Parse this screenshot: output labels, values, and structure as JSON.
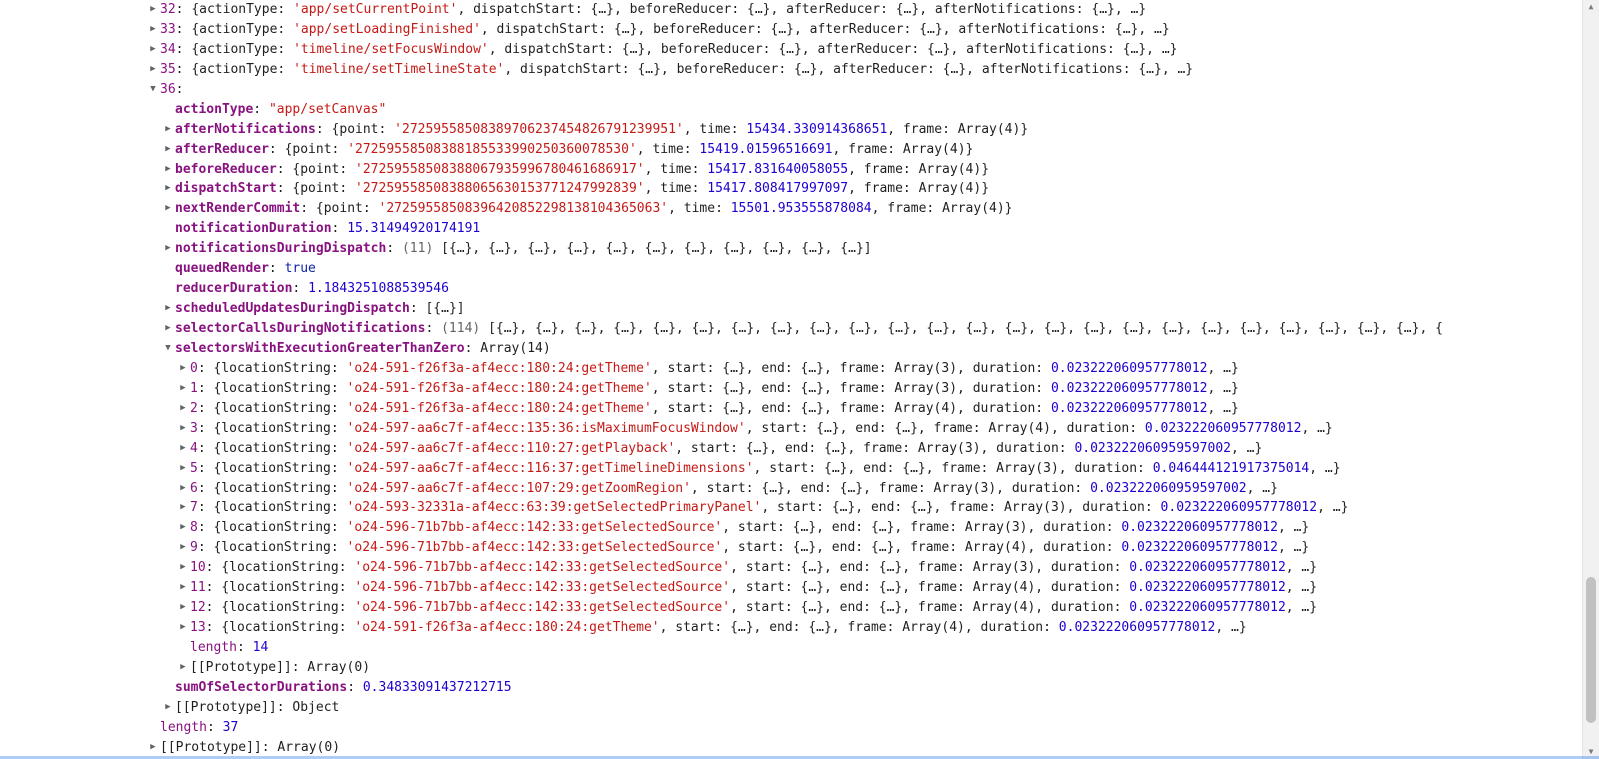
{
  "icons": {
    "collapsed": "▶",
    "expanded": "▼",
    "scroll_up": "▲",
    "scroll_down": "▼"
  },
  "colors": {
    "key": "#881280",
    "string": "#c41a16",
    "number": "#1c00cf",
    "boolean": "#0d22aa",
    "text": "#1f1f1f"
  },
  "lines": [
    {
      "indent": 0,
      "arrow": "collapsed",
      "key": "32",
      "sep": ": ",
      "parts": [
        [
          "plain",
          "{actionType: "
        ],
        [
          "str",
          "'app/setCurrentPoint'"
        ],
        [
          "plain",
          ", dispatchStart: {…}, beforeReducer: {…}, afterReducer: {…}, afterNotifications: {…}, …}"
        ]
      ]
    },
    {
      "indent": 0,
      "arrow": "collapsed",
      "key": "33",
      "sep": ": ",
      "parts": [
        [
          "plain",
          "{actionType: "
        ],
        [
          "str",
          "'app/setLoadingFinished'"
        ],
        [
          "plain",
          ", dispatchStart: {…}, beforeReducer: {…}, afterReducer: {…}, afterNotifications: {…}, …}"
        ]
      ]
    },
    {
      "indent": 0,
      "arrow": "collapsed",
      "key": "34",
      "sep": ": ",
      "parts": [
        [
          "plain",
          "{actionType: "
        ],
        [
          "str",
          "'timeline/setFocusWindow'"
        ],
        [
          "plain",
          ", dispatchStart: {…}, beforeReducer: {…}, afterReducer: {…}, afterNotifications: {…}, …}"
        ]
      ]
    },
    {
      "indent": 0,
      "arrow": "collapsed",
      "key": "35",
      "sep": ": ",
      "parts": [
        [
          "plain",
          "{actionType: "
        ],
        [
          "str",
          "'timeline/setTimelineState'"
        ],
        [
          "plain",
          ", dispatchStart: {…}, beforeReducer: {…}, afterReducer: {…}, afterNotifications: {…}, …}"
        ]
      ]
    },
    {
      "indent": 0,
      "arrow": "expanded",
      "key": "36",
      "sep": ":",
      "parts": []
    },
    {
      "indent": 1,
      "arrow": "",
      "key": "actionType",
      "sep": ": ",
      "parts": [
        [
          "str",
          "\"app/setCanvas\""
        ]
      ]
    },
    {
      "indent": 1,
      "arrow": "collapsed",
      "key": "afterNotifications",
      "sep": ": ",
      "parts": [
        [
          "plain",
          "{point: "
        ],
        [
          "str",
          "'27259558508389706237454826791239951'"
        ],
        [
          "plain",
          ", time: "
        ],
        [
          "num",
          "15434.330914368651"
        ],
        [
          "plain",
          ", frame: Array(4)}"
        ]
      ]
    },
    {
      "indent": 1,
      "arrow": "collapsed",
      "key": "afterReducer",
      "sep": ": ",
      "parts": [
        [
          "plain",
          "{point: "
        ],
        [
          "str",
          "'27259558508388185533990250360078530'"
        ],
        [
          "plain",
          ", time: "
        ],
        [
          "num",
          "15419.01596516691"
        ],
        [
          "plain",
          ", frame: Array(4)}"
        ]
      ]
    },
    {
      "indent": 1,
      "arrow": "collapsed",
      "key": "beforeReducer",
      "sep": ": ",
      "parts": [
        [
          "plain",
          "{point: "
        ],
        [
          "str",
          "'27259558508388067935996780461686917'"
        ],
        [
          "plain",
          ", time: "
        ],
        [
          "num",
          "15417.831640058055"
        ],
        [
          "plain",
          ", frame: Array(4)}"
        ]
      ]
    },
    {
      "indent": 1,
      "arrow": "collapsed",
      "key": "dispatchStart",
      "sep": ": ",
      "parts": [
        [
          "plain",
          "{point: "
        ],
        [
          "str",
          "'27259558508388065630153771247992839'"
        ],
        [
          "plain",
          ", time: "
        ],
        [
          "num",
          "15417.808417997097"
        ],
        [
          "plain",
          ", frame: Array(4)}"
        ]
      ]
    },
    {
      "indent": 1,
      "arrow": "collapsed",
      "key": "nextRenderCommit",
      "sep": ": ",
      "parts": [
        [
          "plain",
          "{point: "
        ],
        [
          "str",
          "'27259558508396420852298138104365063'"
        ],
        [
          "plain",
          ", time: "
        ],
        [
          "num",
          "15501.953555878084"
        ],
        [
          "plain",
          ", frame: Array(4)}"
        ]
      ]
    },
    {
      "indent": 1,
      "arrow": "",
      "key": "notificationDuration",
      "sep": ": ",
      "parts": [
        [
          "num",
          "15.31494920174191"
        ]
      ]
    },
    {
      "indent": 1,
      "arrow": "collapsed",
      "key": "notificationsDuringDispatch",
      "sep": ": ",
      "parts": [
        [
          "dim",
          "(11) "
        ],
        [
          "plain",
          "[{…}, {…}, {…}, {…}, {…}, {…}, {…}, {…}, {…}, {…}, {…}]"
        ]
      ]
    },
    {
      "indent": 1,
      "arrow": "",
      "key": "queuedRender",
      "sep": ": ",
      "parts": [
        [
          "bool",
          "true"
        ]
      ]
    },
    {
      "indent": 1,
      "arrow": "",
      "key": "reducerDuration",
      "sep": ": ",
      "parts": [
        [
          "num",
          "1.1843251088539546"
        ]
      ]
    },
    {
      "indent": 1,
      "arrow": "collapsed",
      "key": "scheduledUpdatesDuringDispatch",
      "sep": ": ",
      "parts": [
        [
          "plain",
          "[{…}]"
        ]
      ]
    },
    {
      "indent": 1,
      "arrow": "collapsed",
      "key": "selectorCallsDuringNotifications",
      "sep": ": ",
      "parts": [
        [
          "dim",
          "(114) "
        ],
        [
          "plain",
          "[{…}, {…}, {…}, {…}, {…}, {…}, {…}, {…}, {…}, {…}, {…}, {…}, {…}, {…}, {…}, {…}, {…}, {…}, {…}, {…}, {…}, {…}, {…}, {…}, {"
        ]
      ]
    },
    {
      "indent": 1,
      "arrow": "expanded",
      "key": "selectorsWithExecutionGreaterThanZero",
      "sep": ": ",
      "parts": [
        [
          "plain",
          "Array(14)"
        ]
      ]
    },
    {
      "indent": 2,
      "arrow": "collapsed",
      "key": "0",
      "sep": ": ",
      "parts": [
        [
          "plain",
          "{locationString: "
        ],
        [
          "str",
          "'o24-591-f26f3a-af4ecc:180:24:getTheme'"
        ],
        [
          "plain",
          ", start: {…}, end: {…}, frame: Array(3), duration: "
        ],
        [
          "num",
          "0.023222060957778012"
        ],
        [
          "plain",
          ", …}"
        ]
      ]
    },
    {
      "indent": 2,
      "arrow": "collapsed",
      "key": "1",
      "sep": ": ",
      "parts": [
        [
          "plain",
          "{locationString: "
        ],
        [
          "str",
          "'o24-591-f26f3a-af4ecc:180:24:getTheme'"
        ],
        [
          "plain",
          ", start: {…}, end: {…}, frame: Array(3), duration: "
        ],
        [
          "num",
          "0.023222060957778012"
        ],
        [
          "plain",
          ", …}"
        ]
      ]
    },
    {
      "indent": 2,
      "arrow": "collapsed",
      "key": "2",
      "sep": ": ",
      "parts": [
        [
          "plain",
          "{locationString: "
        ],
        [
          "str",
          "'o24-591-f26f3a-af4ecc:180:24:getTheme'"
        ],
        [
          "plain",
          ", start: {…}, end: {…}, frame: Array(4), duration: "
        ],
        [
          "num",
          "0.023222060957778012"
        ],
        [
          "plain",
          ", …}"
        ]
      ]
    },
    {
      "indent": 2,
      "arrow": "collapsed",
      "key": "3",
      "sep": ": ",
      "parts": [
        [
          "plain",
          "{locationString: "
        ],
        [
          "str",
          "'o24-597-aa6c7f-af4ecc:135:36:isMaximumFocusWindow'"
        ],
        [
          "plain",
          ", start: {…}, end: {…}, frame: Array(4), duration: "
        ],
        [
          "num",
          "0.023222060957778012"
        ],
        [
          "plain",
          ", …}"
        ]
      ]
    },
    {
      "indent": 2,
      "arrow": "collapsed",
      "key": "4",
      "sep": ": ",
      "parts": [
        [
          "plain",
          "{locationString: "
        ],
        [
          "str",
          "'o24-597-aa6c7f-af4ecc:110:27:getPlayback'"
        ],
        [
          "plain",
          ", start: {…}, end: {…}, frame: Array(3), duration: "
        ],
        [
          "num",
          "0.023222060959597002"
        ],
        [
          "plain",
          ", …}"
        ]
      ]
    },
    {
      "indent": 2,
      "arrow": "collapsed",
      "key": "5",
      "sep": ": ",
      "parts": [
        [
          "plain",
          "{locationString: "
        ],
        [
          "str",
          "'o24-597-aa6c7f-af4ecc:116:37:getTimelineDimensions'"
        ],
        [
          "plain",
          ", start: {…}, end: {…}, frame: Array(3), duration: "
        ],
        [
          "num",
          "0.046444121917375014"
        ],
        [
          "plain",
          ", …}"
        ]
      ]
    },
    {
      "indent": 2,
      "arrow": "collapsed",
      "key": "6",
      "sep": ": ",
      "parts": [
        [
          "plain",
          "{locationString: "
        ],
        [
          "str",
          "'o24-597-aa6c7f-af4ecc:107:29:getZoomRegion'"
        ],
        [
          "plain",
          ", start: {…}, end: {…}, frame: Array(3), duration: "
        ],
        [
          "num",
          "0.023222060959597002"
        ],
        [
          "plain",
          ", …}"
        ]
      ]
    },
    {
      "indent": 2,
      "arrow": "collapsed",
      "key": "7",
      "sep": ": ",
      "parts": [
        [
          "plain",
          "{locationString: "
        ],
        [
          "str",
          "'o24-593-32331a-af4ecc:63:39:getSelectedPrimaryPanel'"
        ],
        [
          "plain",
          ", start: {…}, end: {…}, frame: Array(3), duration: "
        ],
        [
          "num",
          "0.023222060957778012"
        ],
        [
          "plain",
          ", …}"
        ]
      ]
    },
    {
      "indent": 2,
      "arrow": "collapsed",
      "key": "8",
      "sep": ": ",
      "parts": [
        [
          "plain",
          "{locationString: "
        ],
        [
          "str",
          "'o24-596-71b7bb-af4ecc:142:33:getSelectedSource'"
        ],
        [
          "plain",
          ", start: {…}, end: {…}, frame: Array(3), duration: "
        ],
        [
          "num",
          "0.023222060957778012"
        ],
        [
          "plain",
          ", …}"
        ]
      ]
    },
    {
      "indent": 2,
      "arrow": "collapsed",
      "key": "9",
      "sep": ": ",
      "parts": [
        [
          "plain",
          "{locationString: "
        ],
        [
          "str",
          "'o24-596-71b7bb-af4ecc:142:33:getSelectedSource'"
        ],
        [
          "plain",
          ", start: {…}, end: {…}, frame: Array(4), duration: "
        ],
        [
          "num",
          "0.023222060957778012"
        ],
        [
          "plain",
          ", …}"
        ]
      ]
    },
    {
      "indent": 2,
      "arrow": "collapsed",
      "key": "10",
      "sep": ": ",
      "parts": [
        [
          "plain",
          "{locationString: "
        ],
        [
          "str",
          "'o24-596-71b7bb-af4ecc:142:33:getSelectedSource'"
        ],
        [
          "plain",
          ", start: {…}, end: {…}, frame: Array(3), duration: "
        ],
        [
          "num",
          "0.023222060957778012"
        ],
        [
          "plain",
          ", …}"
        ]
      ]
    },
    {
      "indent": 2,
      "arrow": "collapsed",
      "key": "11",
      "sep": ": ",
      "parts": [
        [
          "plain",
          "{locationString: "
        ],
        [
          "str",
          "'o24-596-71b7bb-af4ecc:142:33:getSelectedSource'"
        ],
        [
          "plain",
          ", start: {…}, end: {…}, frame: Array(4), duration: "
        ],
        [
          "num",
          "0.023222060957778012"
        ],
        [
          "plain",
          ", …}"
        ]
      ]
    },
    {
      "indent": 2,
      "arrow": "collapsed",
      "key": "12",
      "sep": ": ",
      "parts": [
        [
          "plain",
          "{locationString: "
        ],
        [
          "str",
          "'o24-596-71b7bb-af4ecc:142:33:getSelectedSource'"
        ],
        [
          "plain",
          ", start: {…}, end: {…}, frame: Array(4), duration: "
        ],
        [
          "num",
          "0.023222060957778012"
        ],
        [
          "plain",
          ", …}"
        ]
      ]
    },
    {
      "indent": 2,
      "arrow": "collapsed",
      "key": "13",
      "sep": ": ",
      "parts": [
        [
          "plain",
          "{locationString: "
        ],
        [
          "str",
          "'o24-591-f26f3a-af4ecc:180:24:getTheme'"
        ],
        [
          "plain",
          ", start: {…}, end: {…}, frame: Array(4), duration: "
        ],
        [
          "num",
          "0.023222060957778012"
        ],
        [
          "plain",
          ", …}"
        ]
      ]
    },
    {
      "indent": 2,
      "arrow": "",
      "key": "length",
      "sep": ": ",
      "parts": [
        [
          "num",
          "14"
        ]
      ]
    },
    {
      "indent": 2,
      "arrow": "collapsed",
      "key": "[[Prototype]]",
      "sep": ": ",
      "parts": [
        [
          "plain",
          "Array(0)"
        ]
      ]
    },
    {
      "indent": 1,
      "arrow": "",
      "key": "sumOfSelectorDurations",
      "sep": ": ",
      "parts": [
        [
          "num",
          "0.34833091437212715"
        ]
      ]
    },
    {
      "indent": 1,
      "arrow": "collapsed",
      "key": "[[Prototype]]",
      "sep": ": ",
      "parts": [
        [
          "plain",
          "Object"
        ]
      ]
    },
    {
      "indent": 0,
      "arrow": "",
      "key": "length",
      "sep": ": ",
      "parts": [
        [
          "num",
          "37"
        ]
      ]
    },
    {
      "indent": 0,
      "arrow": "collapsed",
      "key": "[[Prototype]]",
      "sep": ": ",
      "parts": [
        [
          "plain",
          "Array(0)"
        ]
      ]
    }
  ]
}
